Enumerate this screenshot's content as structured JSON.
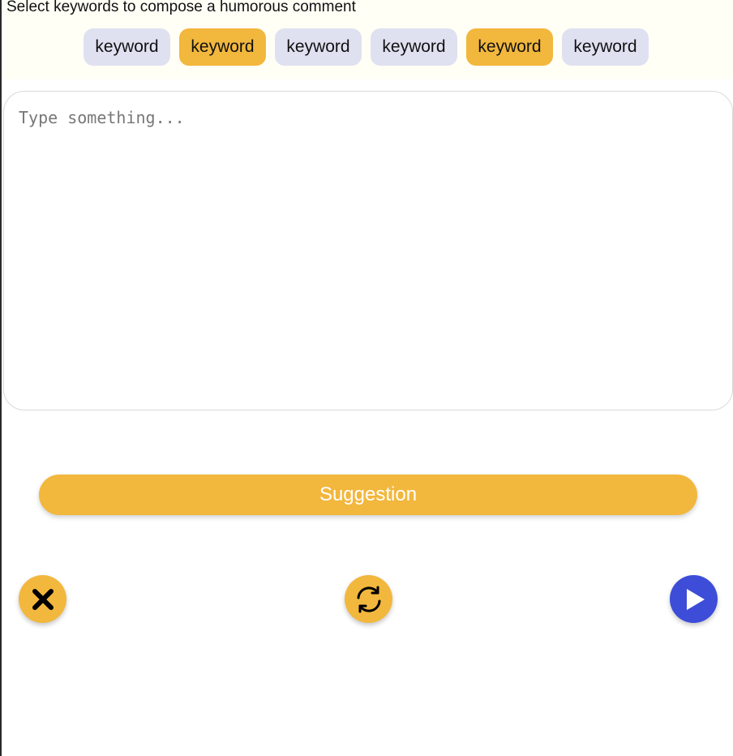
{
  "header": {
    "instruction": "Select keywords to compose a humorous comment"
  },
  "keywords": [
    {
      "label": "keyword",
      "selected": false
    },
    {
      "label": "keyword",
      "selected": true
    },
    {
      "label": "keyword",
      "selected": false
    },
    {
      "label": "keyword",
      "selected": false
    },
    {
      "label": "keyword",
      "selected": true
    },
    {
      "label": "keyword",
      "selected": false
    }
  ],
  "comment": {
    "placeholder": "Type something...",
    "value": ""
  },
  "actions": {
    "suggestion_label": "Suggestion",
    "close_icon": "close-icon",
    "refresh_icon": "refresh-icon",
    "send_icon": "play-icon"
  },
  "colors": {
    "accent": "#f2b73d",
    "chip_default": "#dfe1f1",
    "send": "#3d4dd8"
  }
}
